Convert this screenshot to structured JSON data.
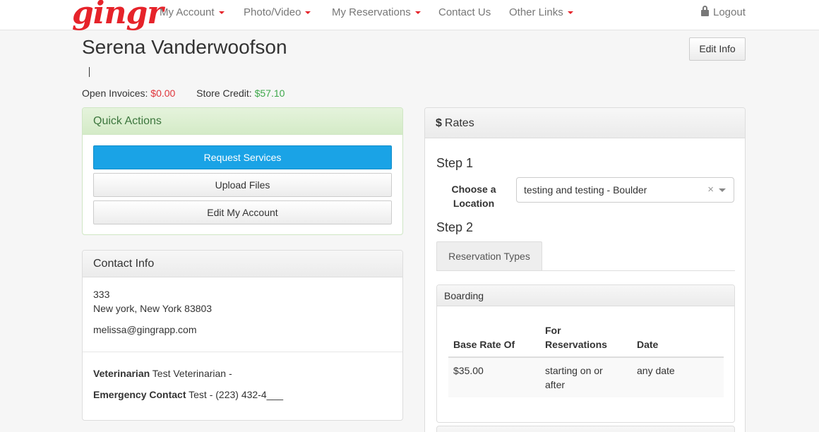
{
  "brand": {
    "logo": "gingr",
    "accent": "#e6232a"
  },
  "nav": {
    "items": [
      {
        "label": "My Account",
        "dropdown": true
      },
      {
        "label": "Photo/Video",
        "dropdown": true
      },
      {
        "label": "My Reservations",
        "dropdown": true
      },
      {
        "label": "Contact Us",
        "dropdown": false
      },
      {
        "label": "Other Links",
        "dropdown": true
      }
    ],
    "logout": "Logout"
  },
  "header": {
    "name": "Serena Vanderwoofson",
    "edit_info": "Edit Info",
    "open_invoices_label": "Open Invoices:",
    "open_invoices_value": "$0.00",
    "store_credit_label": "Store Credit:",
    "store_credit_value": "$57.10"
  },
  "quick_actions": {
    "title": "Quick Actions",
    "buttons": [
      "Request Services",
      "Upload Files",
      "Edit My Account"
    ]
  },
  "contact": {
    "title": "Contact Info",
    "address_line1": "333",
    "address_line2": "New york, New York 83803",
    "email": "melissa@gingrapp.com",
    "vet_label": "Veterinarian",
    "vet_value": "Test Veterinarian -",
    "emergency_label": "Emergency Contact",
    "emergency_value": "Test - (223) 432-4___"
  },
  "rates": {
    "title": "Rates",
    "step1": "Step 1",
    "choose_location_label": "Choose a Location",
    "location_value": "testing and testing - Boulder",
    "step2": "Step 2",
    "tab_label": "Reservation Types",
    "boarding": {
      "title": "Boarding",
      "columns": [
        "Base Rate Of",
        "For Reservations",
        "Date"
      ],
      "rows": [
        [
          "$35.00",
          "starting on or after",
          "any date"
        ]
      ]
    }
  }
}
